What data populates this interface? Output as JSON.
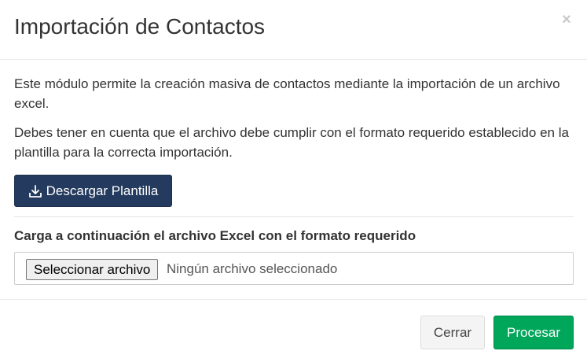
{
  "dialog": {
    "title": "Importación de Contactos",
    "close_symbol": "×"
  },
  "body": {
    "intro": "Este módulo permite la creación masiva de contactos mediante la importación de un archivo excel.",
    "notice": "Debes tener en cuenta que el archivo debe cumplir con el formato requerido establecido en la plantilla para la correcta importación.",
    "download_button": {
      "label": "Descargar Plantilla",
      "icon": "download-icon",
      "color": "#243a5e"
    },
    "upload_label": "Carga a continuación el archivo Excel con el formato requerido",
    "file_input": {
      "button_label": "Seleccionar archivo",
      "status": "Ningún archivo seleccionado"
    }
  },
  "footer": {
    "close_label": "Cerrar",
    "process_label": "Procesar",
    "process_color": "#00a65a"
  }
}
